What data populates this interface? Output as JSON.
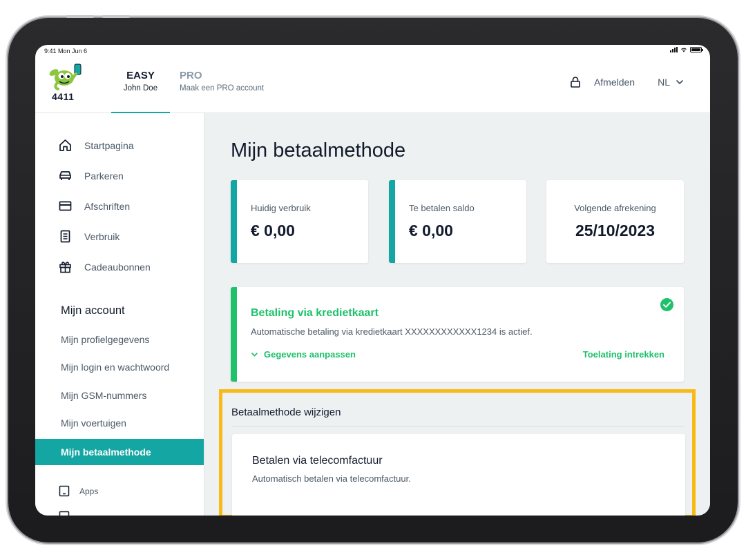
{
  "status_bar": {
    "time": "9:41  Mon Jun 6"
  },
  "brand": {
    "logo_text": "4411"
  },
  "account_tabs": [
    {
      "title": "EASY",
      "subtitle": "John Doe"
    },
    {
      "title": "PRO",
      "subtitle": "Maak een PRO account"
    }
  ],
  "header": {
    "logout_label": "Afmelden",
    "language": "NL"
  },
  "sidebar": {
    "nav": [
      {
        "label": "Startpagina",
        "icon": "home-icon"
      },
      {
        "label": "Parkeren",
        "icon": "car-icon"
      },
      {
        "label": "Afschriften",
        "icon": "card-icon"
      },
      {
        "label": "Verbruik",
        "icon": "document-icon"
      },
      {
        "label": "Cadeaubonnen",
        "icon": "gift-icon"
      }
    ],
    "account_title": "Mijn account",
    "account_links": [
      "Mijn profielgegevens",
      "Mijn login en wachtwoord",
      "Mijn GSM-nummers",
      "Mijn voertuigen",
      "Mijn betaalmethode"
    ],
    "active_link": "Mijn betaalmethode",
    "extra": [
      {
        "label": "Apps",
        "icon": "tablet-icon"
      }
    ]
  },
  "main": {
    "title": "Mijn betaalmethode",
    "stats": [
      {
        "label": "Huidig verbruik",
        "value": "€ 0,00"
      },
      {
        "label": "Te betalen saldo",
        "value": "€ 0,00"
      },
      {
        "label": "Volgende afrekening",
        "value": "25/10/2023"
      }
    ],
    "payment": {
      "title": "Betaling via kredietkaart",
      "description": "Automatische betaling via kredietkaart XXXXXXXXXXXX1234 is actief.",
      "edit_label": "Gegevens aanpassen",
      "revoke_label": "Toelating intrekken"
    },
    "change": {
      "title": "Betaalmethode wijzigen",
      "option_title": "Betalen via telecomfactuur",
      "option_desc": "Automatisch betalen via telecomfactuur."
    }
  },
  "colors": {
    "teal": "#13a6a3",
    "green": "#1fc16b",
    "highlight": "#f9b917",
    "navy": "#121b2c"
  }
}
